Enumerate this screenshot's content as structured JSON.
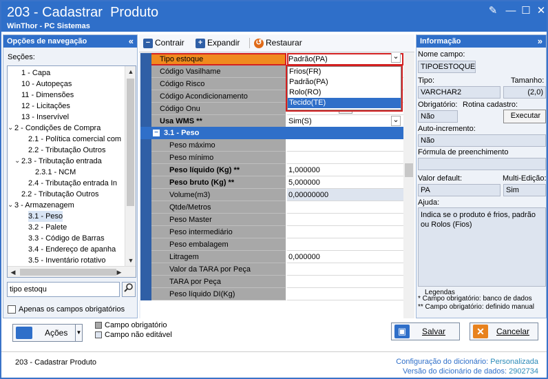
{
  "window": {
    "title": "203 - Cadastrar  Produto",
    "subtitle": "WinThor - PC Sistemas"
  },
  "nav": {
    "title": "Opções de navegação",
    "secoes_label": "Seções:",
    "tree": [
      {
        "label": "1 - Capa",
        "indent": 1
      },
      {
        "label": "10 - Autopeças",
        "indent": 1
      },
      {
        "label": "11 - Dimensões",
        "indent": 1
      },
      {
        "label": "12 - Licitações",
        "indent": 1
      },
      {
        "label": "13 - Inservível",
        "indent": 1
      },
      {
        "label": "2 - Condições de Compra",
        "indent": 0,
        "expanded": true
      },
      {
        "label": "2.1 - Política comercial com",
        "indent": 2
      },
      {
        "label": "2.2 - Tributação Outros",
        "indent": 2
      },
      {
        "label": "2.3 - Tributação entrada",
        "indent": 1,
        "expanded": true
      },
      {
        "label": "2.3.1 - NCM",
        "indent": 3
      },
      {
        "label": "2.4 - Tributação entrada In",
        "indent": 2
      },
      {
        "label": "2.2 - Tributação Outros",
        "indent": 1
      },
      {
        "label": "3 - Armazenagem",
        "indent": 0,
        "expanded": true
      },
      {
        "label": "3.1 - Peso",
        "indent": 2
      },
      {
        "label": "3.2 - Palete",
        "indent": 2
      },
      {
        "label": "3.3 - Código de Barras",
        "indent": 2
      },
      {
        "label": "3.4 - Endereço de apanha",
        "indent": 2
      },
      {
        "label": "3.5 - Inventário rotativo",
        "indent": 2
      }
    ],
    "search_value": "tipo estoqu",
    "only_required_label": "Apenas os campos obrigatórios"
  },
  "toolbar": {
    "collapse": "Contrair",
    "expand": "Expandir",
    "restore": "Restaurar"
  },
  "grid": {
    "top_rows": [
      {
        "label": "Tipo estoque",
        "value": "Padrão(PA)",
        "bold": false
      },
      {
        "label": "Código Vasilhame",
        "value": "",
        "bold": false
      },
      {
        "label": "Código Risco",
        "value": "",
        "bold": false
      },
      {
        "label": "Código Acondicionamento",
        "value": "",
        "bold": false
      },
      {
        "label": "Código Onu",
        "value": "",
        "bold": false
      },
      {
        "label": "Usa WMS **",
        "value": "Sim(S)",
        "bold": true
      }
    ],
    "section": "3.1 - Peso",
    "peso_rows": [
      {
        "label": "Peso máximo",
        "value": "",
        "bold": false
      },
      {
        "label": "Peso mínimo",
        "value": "",
        "bold": false
      },
      {
        "label": "Peso líquido (Kg) **",
        "value": "1,000000",
        "bold": true
      },
      {
        "label": "Peso bruto (Kg) **",
        "value": "5,000000",
        "bold": true
      },
      {
        "label": "Volume(m3)",
        "value": "0,00000000",
        "bold": false
      },
      {
        "label": "Qtde/Metros",
        "value": "",
        "bold": false
      },
      {
        "label": "Peso Master",
        "value": "",
        "bold": false
      },
      {
        "label": "Peso intermediário",
        "value": "",
        "bold": false
      },
      {
        "label": "Peso embalagem",
        "value": "",
        "bold": false
      },
      {
        "label": "Litragem",
        "value": "0,000000",
        "bold": false
      },
      {
        "label": "Valor da TARA por Peça",
        "value": "",
        "bold": false
      },
      {
        "label": "TARA por Peça",
        "value": "",
        "bold": false
      },
      {
        "label": "Peso líquido DI(Kg)",
        "value": "",
        "bold": false
      }
    ],
    "dropdown": [
      "Frios(FR)",
      "Padrão(PA)",
      "Rolo(RO)",
      "Tecido(TE)"
    ],
    "dropdown_selected": "Tecido(TE)",
    "ellipsis": "..."
  },
  "info": {
    "title": "Informação",
    "nome_campo_label": "Nome campo:",
    "nome_campo": "TIPOESTOQUE",
    "tipo_label": "Tipo:",
    "tipo": "VARCHAR2",
    "tamanho_label": "Tamanho:",
    "tamanho": "(2,0)",
    "obrig_label": "Obrigatório:",
    "rotina_label": "Rotina cadastro:",
    "obrig": "Não",
    "executar": "Executar",
    "autoinc_label": "Auto-incremento:",
    "autoinc": "Não",
    "formula_label": "Fórmula de preenchimento",
    "formula": "",
    "default_label": "Valor default:",
    "multi_label": "Multi-Edição:",
    "default": "PA",
    "multi": "Sim",
    "ajuda_label": "Ajuda:",
    "ajuda": "Indica se o produto é frios, padrão ou Rolos (Fios)",
    "legend_title": "Legendas",
    "legend1": "* Campo obrigatório: banco de dados",
    "legend2": "** Campo obrigatório: definido manual"
  },
  "buttons": {
    "acoes": "Ações",
    "campo_obrig": "Campo obrigatório",
    "campo_nao_edit": "Campo não editável",
    "salvar": "Salvar",
    "cancelar": "Cancelar"
  },
  "status": {
    "left": "203 - Cadastrar  Produto",
    "config_label": "Configuração do dicionário:",
    "config": "Personalizada",
    "versao_label": "Versão do dicionário de dados:",
    "versao": "2902734"
  }
}
